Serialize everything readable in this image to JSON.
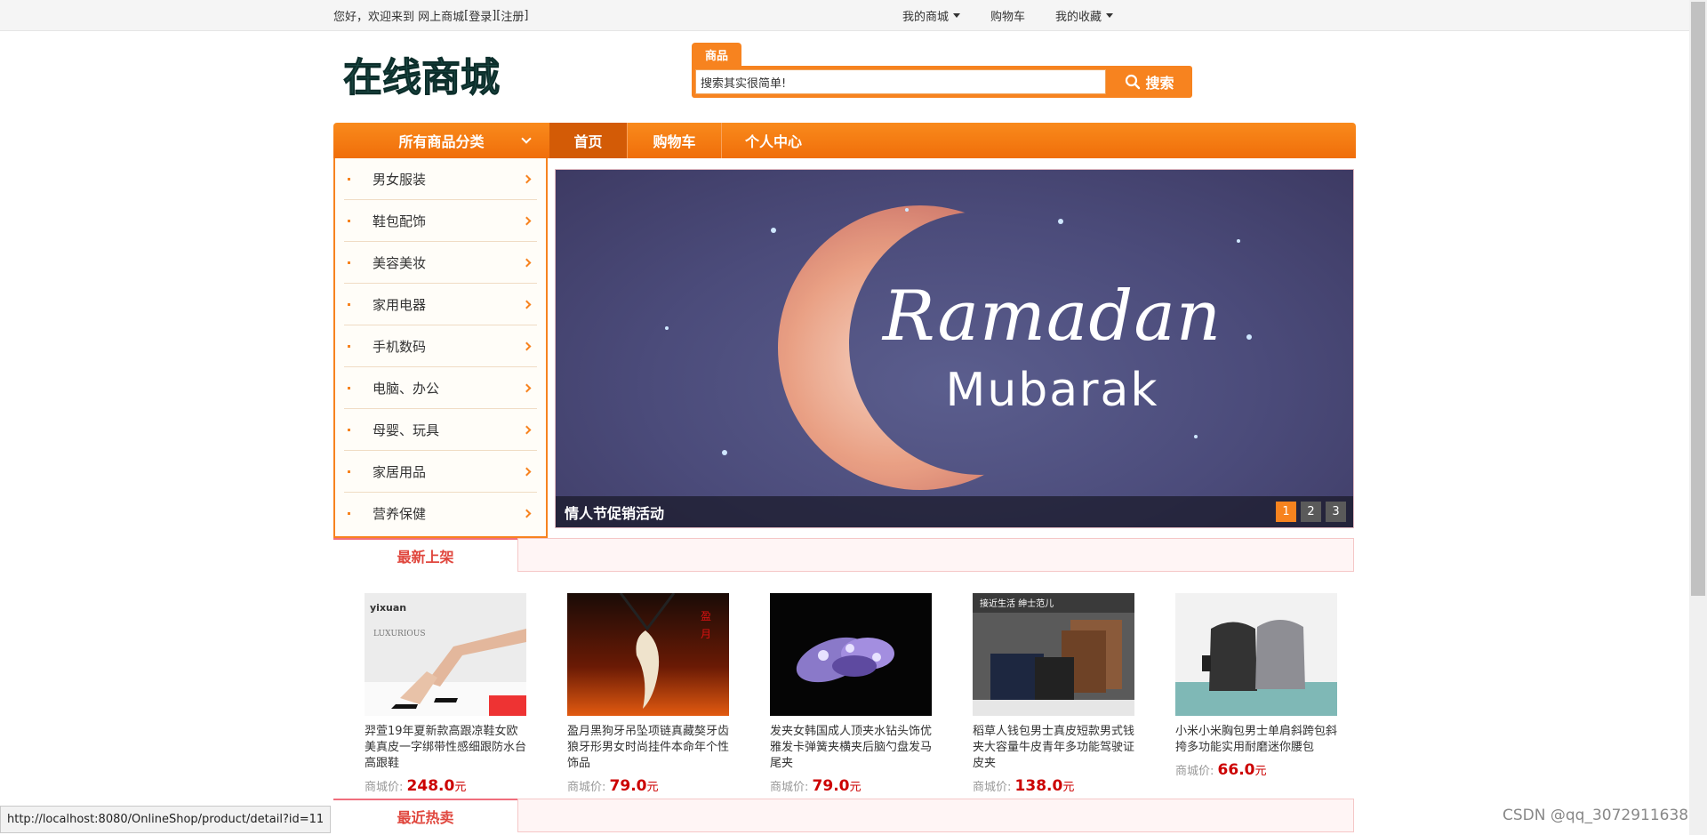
{
  "topbar": {
    "greeting": "您好，欢迎来到 网上商城 ",
    "bracket_open": "[ ",
    "login": "登录",
    "separator": " ][ ",
    "register": "注册",
    "bracket_close": " ]",
    "my_mall": "我的商城",
    "cart": "购物车",
    "favorites": "我的收藏"
  },
  "header": {
    "logo_text": "在线商城",
    "search_tab": "商品",
    "search_value": "搜索其实很简单!",
    "search_button": "搜索"
  },
  "nav": {
    "category_title": "所有商品分类",
    "items": [
      "首页",
      "购物车",
      "个人中心"
    ]
  },
  "categories": [
    "男女服装",
    "鞋包配饰",
    "美容美妆",
    "家用电器",
    "手机数码",
    "电脑、办公",
    "母婴、玩具",
    "家居用品",
    "营养保健"
  ],
  "banner": {
    "headline": "Ramadan",
    "subline": "Mubarak",
    "caption": "情人节促销活动",
    "pages": [
      "1",
      "2",
      "3"
    ],
    "active_page": "1"
  },
  "sections": {
    "new_arrivals": "最新上架",
    "hot_sales": "最近热卖"
  },
  "price_label": "商城价:",
  "currency_unit": "元",
  "products": [
    {
      "name": "羿萱19年夏新款高跟凉鞋女欧美真皮一字绑带性感细跟防水台高跟鞋",
      "price": "248.0"
    },
    {
      "name": "盈月黑狗牙吊坠项链真藏獒牙齿狼牙形男女时尚挂件本命年个性饰品",
      "price": "79.0"
    },
    {
      "name": "发夹女韩国成人顶夹水钻头饰优雅发卡弹簧夹横夹后脑勺盘发马尾夹",
      "price": "79.0"
    },
    {
      "name": "稻草人钱包男士真皮短款男式钱夹大容量牛皮青年多功能驾驶证皮夹",
      "price": "138.0"
    },
    {
      "name": "小米小米胸包男士单肩斜跨包斜挎多功能实用耐磨迷你腰包",
      "price": "66.0"
    }
  ],
  "status_url": "http://localhost:8080/OnlineShop/product/detail?id=11",
  "watermark": "CSDN @qq_3072911638",
  "colors": {
    "accent": "#f7831f",
    "price": "#cc0000",
    "section_title": "#e0473e"
  }
}
